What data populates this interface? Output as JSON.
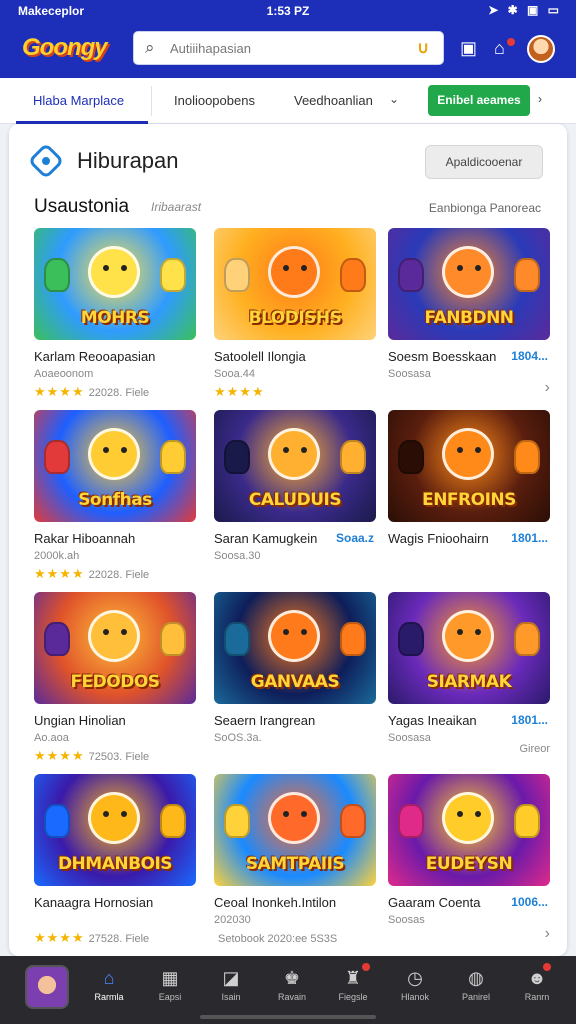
{
  "status_bar": {
    "carrier": "Makeceplor",
    "time": "1:53 PZ",
    "icons": "➤ ✱ ▣ ▭"
  },
  "header": {
    "logo": "Goongy",
    "search_placeholder": "Autiiihapasian",
    "icons": [
      "search-icon",
      "mic-icon",
      "play-icon",
      "cart-icon",
      "avatar"
    ]
  },
  "tabs": {
    "items": [
      "Hlaba Marplace",
      "Inolioopobens",
      "Veedhoanlian"
    ],
    "active_index": 0,
    "cta_label": "Enibel aeames"
  },
  "panel": {
    "title": "Hiburapan",
    "button_label": "Apaldicooenar",
    "section_title": "Usaustonia",
    "section_sub": "Iribaarast",
    "section_link": "Eanbionga Panoreac"
  },
  "cards": [
    {
      "art": "MOHRS",
      "title": "Karlam Reooapasian",
      "sub": "Aoaeoonom",
      "stars": "★★★★",
      "meta": "22028. Fiele",
      "price": "",
      "trail": "",
      "bg": [
        "#2f9bff",
        "#ffe14a",
        "#3bbf5b"
      ]
    },
    {
      "art": "BLODISHS",
      "title": "Satoolell Ilongia",
      "sub": "Sooa.44",
      "stars": "★★★★",
      "meta": "",
      "price": "",
      "trail": "",
      "bg": [
        "#ffb020",
        "#ff7a18",
        "#ffd27a"
      ]
    },
    {
      "art": "FANBDNN",
      "title": "Soesm Boesskaan",
      "sub": "Soosasa",
      "stars": "",
      "meta": "",
      "price": "1804...",
      "trail": "›",
      "bg": [
        "#2a3ab8",
        "#ff8a2a",
        "#5a2a9a"
      ]
    },
    {
      "art": "Sonfhas",
      "title": "Rakar Hiboannah",
      "sub": "2000k.ah",
      "stars": "★★★★",
      "meta": "22028. Fiele",
      "price": "",
      "trail": "",
      "bg": [
        "#1e5fff",
        "#ffcc33",
        "#e23a3a"
      ]
    },
    {
      "art": "CALUDUIS",
      "title": "Saran Kamugkein",
      "sub": "Soosa.30",
      "stars": "",
      "meta": "",
      "price": "Soaa.z",
      "trail": "",
      "bg": [
        "#3a2a8a",
        "#ffb030",
        "#1a1a4a"
      ]
    },
    {
      "art": "ENFROINS",
      "title": "Wagis Fnioohairn",
      "sub": "",
      "stars": "",
      "meta": "",
      "price": "1801...",
      "trail": "",
      "bg": [
        "#5a1e0e",
        "#ff8a1a",
        "#2a0e06"
      ]
    },
    {
      "art": "FEDODOS",
      "title": "Ungian Hinolian",
      "sub": "Ao.aoa",
      "stars": "★★★★",
      "meta": "72503. Fiele",
      "price": "",
      "trail": "",
      "bg": [
        "#e0532a",
        "#ffbf3a",
        "#5a2a9a"
      ]
    },
    {
      "art": "GANVAAS",
      "title": "Seaern Irangrean",
      "sub": "SoOS.3a.",
      "stars": "",
      "meta": "",
      "price": "",
      "trail": "",
      "bg": [
        "#0e1e5a",
        "#ff7a1a",
        "#1a6a9a"
      ]
    },
    {
      "art": "SIARMAK",
      "title": "Yagas Ineaikan",
      "sub": "Soosasa",
      "stars": "",
      "meta": "",
      "price": "1801...",
      "trail": "Gireor",
      "bg": [
        "#6a2aba",
        "#ff9a2a",
        "#2a1a6a"
      ]
    },
    {
      "art": "DHMANBOIS",
      "title": "Kanaagra Hornosian",
      "sub": "",
      "stars": "★★★★",
      "meta": "27528. Fiele",
      "price": "",
      "trail": "",
      "bg": [
        "#3a1aaa",
        "#ffb81a",
        "#1a6aff"
      ]
    },
    {
      "art": "SAMTPAIIS",
      "title": "Ceoal Inonkeh.Intilon",
      "sub": "202030",
      "stars": "",
      "meta": "Setobook 2020:ee 5S3S",
      "price": "",
      "trail": "",
      "bg": [
        "#1a8aff",
        "#ff6a2a",
        "#ffd23a"
      ]
    },
    {
      "art": "EUDEYSN",
      "title": "Gaaram Coenta",
      "sub": "Soosas",
      "stars": "",
      "meta": "",
      "price": "1006...",
      "trail": "›",
      "bg": [
        "#6a1aaa",
        "#ffcc2a",
        "#e02a8a"
      ]
    }
  ],
  "bottom_nav": {
    "items": [
      {
        "label": "Rarmla",
        "icon": "home-icon",
        "glyph": "⌂"
      },
      {
        "label": "Eapsi",
        "icon": "grid-icon",
        "glyph": "▦"
      },
      {
        "label": "Isain",
        "icon": "tag-icon",
        "glyph": "◪"
      },
      {
        "label": "Ravain",
        "icon": "people-icon",
        "glyph": "♚"
      },
      {
        "label": "Fiegsle",
        "icon": "bell-icon",
        "glyph": "♜"
      },
      {
        "label": "Hlanok",
        "icon": "clock-icon",
        "glyph": "◷"
      },
      {
        "label": "Panirel",
        "icon": "chat-icon",
        "glyph": "◍"
      },
      {
        "label": "Ranrn",
        "icon": "profile-icon",
        "glyph": "☻"
      }
    ],
    "active_index": 0
  },
  "colors": {
    "brand": "#1d2fb8",
    "cta": "#21a84a",
    "star": "#f5b400",
    "price": "#1d7fd6"
  }
}
